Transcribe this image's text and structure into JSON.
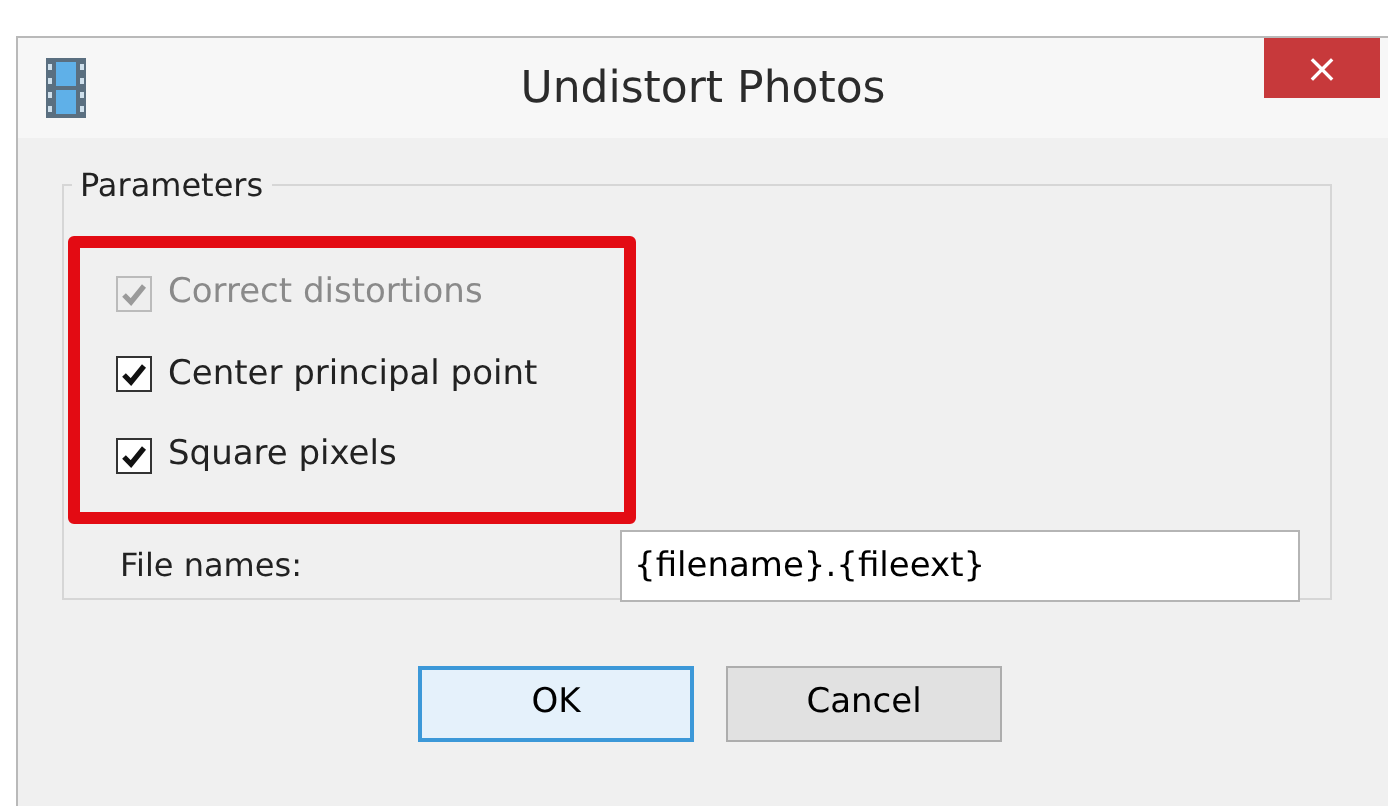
{
  "window": {
    "title": "Undistort Photos",
    "close": "×"
  },
  "group": {
    "title": "Parameters",
    "options": [
      {
        "label": "Correct distortions",
        "checked": true,
        "disabled": true
      },
      {
        "label": "Center principal point",
        "checked": true,
        "disabled": false
      },
      {
        "label": "Square pixels",
        "checked": true,
        "disabled": false
      }
    ],
    "file_names": {
      "label": "File names:",
      "value": "{filename}.{fileext}"
    }
  },
  "buttons": [
    {
      "label": "OK",
      "default": true
    },
    {
      "label": "Cancel",
      "default": false
    }
  ]
}
